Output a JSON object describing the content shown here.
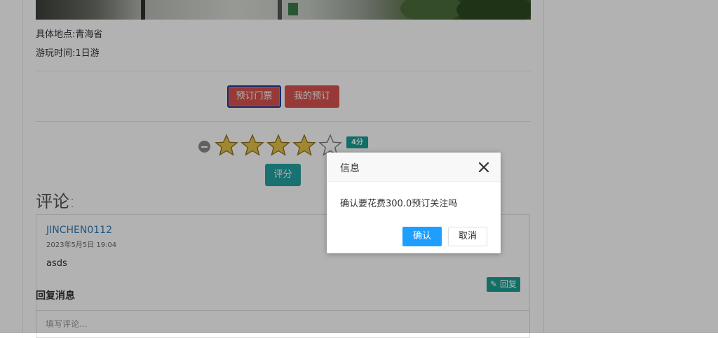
{
  "attraction": {
    "location_label": "具体地点:青海省",
    "duration_label": "游玩时间:1日游"
  },
  "actions": {
    "book_ticket": "预订门票",
    "my_bookings": "我的预订"
  },
  "rating": {
    "stars_filled": 4,
    "stars_total": 5,
    "badge": "4分",
    "rate_button": "评分",
    "star_color": "#e6c34a"
  },
  "comments": {
    "title": "评论:",
    "items": [
      {
        "user": "JINCHEN0112",
        "time": "2023年5月5日 19:04",
        "text": "asds",
        "reply_button": "回复"
      }
    ],
    "reply_section_title": "回复消息",
    "reply_placeholder": "填写评论..."
  },
  "dialog": {
    "title": "信息",
    "message": "确认要花费300.0预订关注吗",
    "confirm": "确认",
    "cancel": "取消",
    "confirm_color": "#1e9fff"
  },
  "colors": {
    "danger": "#d9534f",
    "teal": "#26a2a4",
    "green_badge": "#1aa094"
  }
}
